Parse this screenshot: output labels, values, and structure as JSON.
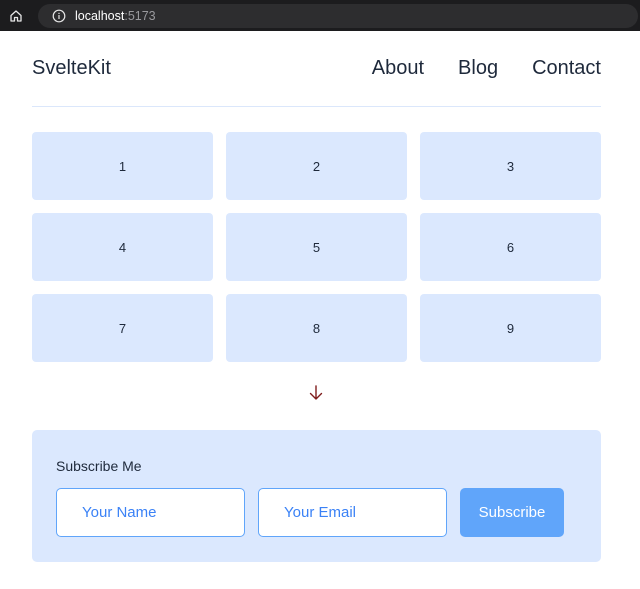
{
  "browser": {
    "url_host": "localhost",
    "url_port": ":5173",
    "icons": [
      "home-icon",
      "info-icon"
    ]
  },
  "header": {
    "brand": "SvelteKit",
    "nav": [
      {
        "label": "About"
      },
      {
        "label": "Blog"
      },
      {
        "label": "Contact"
      }
    ]
  },
  "grid": {
    "items": [
      "1",
      "2",
      "3",
      "4",
      "5",
      "6",
      "7",
      "8",
      "9"
    ]
  },
  "scroll_indicator": {
    "icon": "arrow-down-icon",
    "color": "#7f1d1d"
  },
  "subscribe": {
    "title": "Subscribe Me",
    "name_placeholder": "Your Name",
    "email_placeholder": "Your Email",
    "button_label": "Subscribe"
  },
  "colors": {
    "card_bg": "#dbe8fe",
    "accent": "#60a5fa",
    "placeholder": "#3b82f6",
    "text": "#1e293b"
  }
}
